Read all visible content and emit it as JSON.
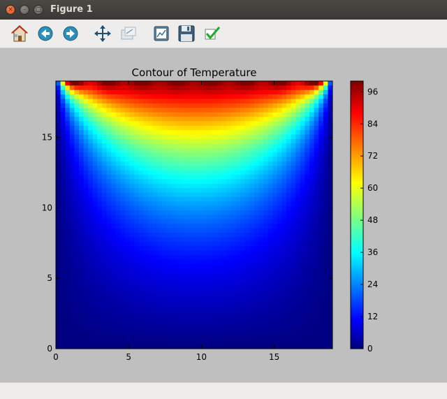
{
  "window": {
    "title": "Figure 1",
    "close_glyph": "×",
    "min_glyph": "–",
    "max_glyph": "□"
  },
  "toolbar": {
    "buttons": [
      {
        "name": "home-button",
        "icon": "home-icon"
      },
      {
        "name": "back-button",
        "icon": "back-arrow-icon"
      },
      {
        "name": "forward-button",
        "icon": "forward-arrow-icon"
      },
      {
        "name": "pan-button",
        "icon": "move-icon"
      },
      {
        "name": "zoom-button",
        "icon": "zoom-icon"
      },
      {
        "name": "configure-subplots-button",
        "icon": "subplots-icon"
      },
      {
        "name": "save-button",
        "icon": "floppy-disk-icon"
      },
      {
        "name": "edit-parameters-button",
        "icon": "checkmark-icon"
      }
    ]
  },
  "chart_data": {
    "type": "heatmap",
    "title": "Contour of Temperature",
    "xlabel": "",
    "ylabel": "",
    "xlim": [
      0,
      19
    ],
    "ylim": [
      0,
      19
    ],
    "xticks": [
      "0",
      "5",
      "10",
      "15"
    ],
    "yticks": [
      "0",
      "5",
      "10",
      "15"
    ],
    "colorbar": {
      "ticks": [
        "0",
        "12",
        "24",
        "36",
        "48",
        "60",
        "72",
        "84",
        "96"
      ],
      "range": [
        0,
        100
      ],
      "colormap": "jet"
    },
    "description_values": "Temperature field: top boundary ≈100, bottom and side boundaries ≈0, with gradual decay downward."
  }
}
